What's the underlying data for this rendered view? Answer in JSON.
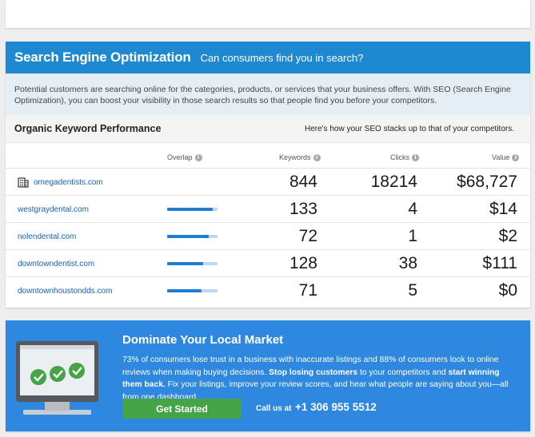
{
  "seo": {
    "title": "Search Engine Optimization",
    "subtitle": "Can consumers find you in search?",
    "description": "Potential customers are searching online for the categories, products, or services that your business offers. With SEO (Search Engine Optimization), you can boost your visibility in those search results so that people find you before your competitors."
  },
  "keywords": {
    "title": "Organic Keyword Performance",
    "note": "Here's how your SEO stacks up to that of your competitors.",
    "columns": {
      "overlap": "Overlap",
      "keywords": "Keywords",
      "clicks": "Clicks",
      "value": "Value"
    },
    "info_icon": "i",
    "rows": [
      {
        "domain": "omegadentists.com",
        "icon": "building-icon",
        "overlap": null,
        "keywords": "844",
        "clicks": "18214",
        "value": "$68,727"
      },
      {
        "domain": "westgraydental.com",
        "overlap": 0.9,
        "keywords": "133",
        "clicks": "4",
        "value": "$14"
      },
      {
        "domain": "nolendental.com",
        "overlap": 0.82,
        "keywords": "72",
        "clicks": "1",
        "value": "$2"
      },
      {
        "domain": "downtowndentist.com",
        "overlap": 0.72,
        "keywords": "128",
        "clicks": "38",
        "value": "$111"
      },
      {
        "domain": "downtownhoustondds.com",
        "overlap": 0.68,
        "keywords": "71",
        "clicks": "5",
        "value": "$0"
      }
    ],
    "colors": {
      "bar_fill": "#1e7fd2",
      "bar_track": "#bcd8f2",
      "link": "#1a62b3"
    }
  },
  "cta": {
    "title": "Dominate Your Local Market",
    "text_1": "73% of consumers lose trust in a business with inaccurate listings and 88% of consumers look to online reviews when making buying decisions. ",
    "text_bold_1": "Stop losing customers",
    "text_2": " to your competitors and ",
    "text_bold_2": "start winning them back.",
    "text_3": " Fix your listings, improve your review scores, and hear what people are saying about you—all from one dashboard.",
    "button": "Get Started",
    "call_label": "Call us at",
    "phone": "+1 306 955 5512",
    "colors": {
      "background": "#2e88e0",
      "button": "#44a447"
    }
  },
  "colors": {
    "header": "#1e88d1",
    "desc_bg": "#e6eef5"
  }
}
